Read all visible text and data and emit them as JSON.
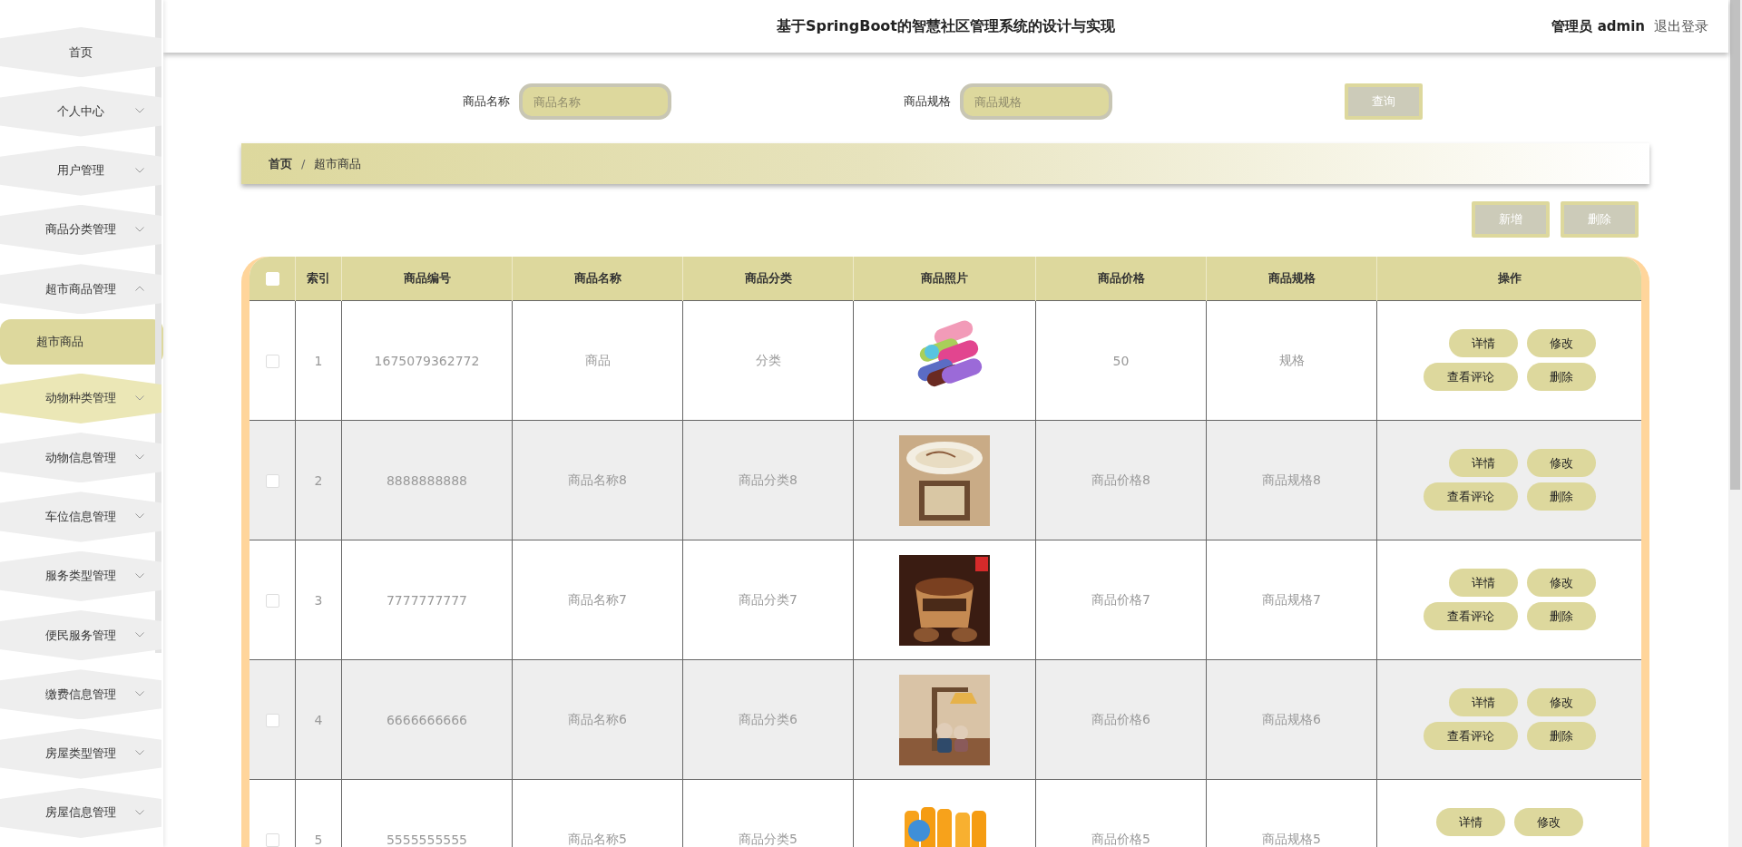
{
  "header": {
    "title": "基于SpringBoot的智慧社区管理系统的设计与实现",
    "user_role": "管理员",
    "user_name": "admin",
    "logout": "退出登录"
  },
  "sidebar": {
    "items": [
      {
        "label": "首页",
        "kind": "link",
        "hovered": false
      },
      {
        "label": "个人中心",
        "kind": "menu",
        "expanded": false,
        "hovered": false
      },
      {
        "label": "用户管理",
        "kind": "menu",
        "expanded": false,
        "hovered": false
      },
      {
        "label": "商品分类管理",
        "kind": "menu",
        "expanded": false,
        "hovered": false
      },
      {
        "label": "超市商品管理",
        "kind": "menu",
        "expanded": true,
        "hovered": false,
        "children": [
          {
            "label": "超市商品",
            "selected": true
          }
        ]
      },
      {
        "label": "动物种类管理",
        "kind": "menu",
        "expanded": false,
        "hovered": true
      },
      {
        "label": "动物信息管理",
        "kind": "menu",
        "expanded": false,
        "hovered": false
      },
      {
        "label": "车位信息管理",
        "kind": "menu",
        "expanded": false,
        "hovered": false
      },
      {
        "label": "服务类型管理",
        "kind": "menu",
        "expanded": false,
        "hovered": false
      },
      {
        "label": "便民服务管理",
        "kind": "menu",
        "expanded": false,
        "hovered": false
      },
      {
        "label": "缴费信息管理",
        "kind": "menu",
        "expanded": false,
        "hovered": false
      },
      {
        "label": "房屋类型管理",
        "kind": "menu",
        "expanded": false,
        "hovered": false
      },
      {
        "label": "房屋信息管理",
        "kind": "menu",
        "expanded": false,
        "hovered": false
      }
    ]
  },
  "search": {
    "fields": [
      {
        "label": "商品名称",
        "placeholder": "商品名称"
      },
      {
        "label": "商品规格",
        "placeholder": "商品规格"
      }
    ],
    "button": "查询"
  },
  "breadcrumb": {
    "items": [
      "首页",
      "超市商品"
    ],
    "separator": "/"
  },
  "toolbar": {
    "buttons": [
      "新增",
      "删除"
    ]
  },
  "table": {
    "select_all": {
      "checked": false
    },
    "columns": [
      "索引",
      "商品编号",
      "商品名称",
      "商品分类",
      "商品照片",
      "商品价格",
      "商品规格",
      "操作"
    ],
    "rows": [
      {
        "checked": false,
        "index": "1",
        "code": "1675079362772",
        "name": "商品",
        "category": "分类",
        "photo": {
          "kind": "picture"
        },
        "price": "50",
        "spec": "规格",
        "actions": [
          "详情",
          "修改",
          "查看评论",
          "删除"
        ]
      },
      {
        "checked": false,
        "index": "2",
        "code": "8888888888",
        "name": "商品名称8",
        "category": "商品分类8",
        "photo": {
          "kind": "picture"
        },
        "price": "商品价格8",
        "spec": "商品规格8",
        "actions": [
          "详情",
          "修改",
          "查看评论",
          "删除"
        ]
      },
      {
        "checked": false,
        "index": "3",
        "code": "7777777777",
        "name": "商品名称7",
        "category": "商品分类7",
        "photo": {
          "kind": "picture"
        },
        "price": "商品价格7",
        "spec": "商品规格7",
        "actions": [
          "详情",
          "修改",
          "查看评论",
          "删除"
        ]
      },
      {
        "checked": false,
        "index": "4",
        "code": "6666666666",
        "name": "商品名称6",
        "category": "商品分类6",
        "photo": {
          "kind": "picture"
        },
        "price": "商品价格6",
        "spec": "商品规格6",
        "actions": [
          "详情",
          "修改",
          "查看评论",
          "删除"
        ]
      },
      {
        "checked": false,
        "index": "5",
        "code": "5555555555",
        "name": "商品名称5",
        "category": "商品分类5",
        "photo": {
          "kind": "picture"
        },
        "price": "商品价格5",
        "spec": "商品规格5",
        "actions": [
          "详情",
          "修改"
        ]
      }
    ]
  }
}
